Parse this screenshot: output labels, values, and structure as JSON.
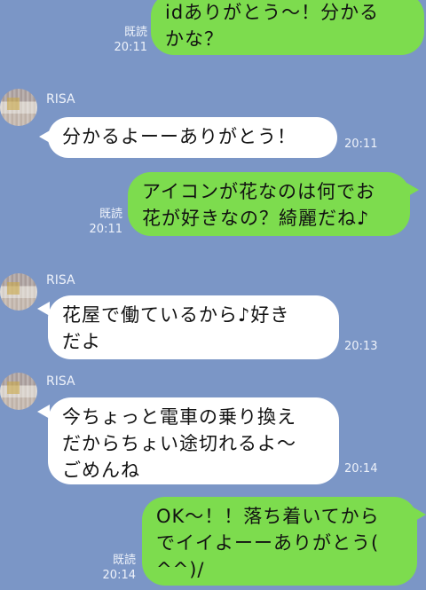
{
  "messages": [
    {
      "id": "m1",
      "side": "out",
      "text": "idありがとう〜！分かる\nかな？",
      "read": "既読",
      "time": "20:11"
    },
    {
      "id": "m2",
      "side": "in",
      "sender": "RISA",
      "text": "分かるよーーありがとう！",
      "time": "20:11"
    },
    {
      "id": "m3",
      "side": "out",
      "text": "アイコンが花なのは何でお\n花が好きなの？綺麗だね♪",
      "read": "既読",
      "time": "20:11"
    },
    {
      "id": "m4",
      "side": "in",
      "sender": "RISA",
      "text": "花屋で働ているから♪好き\nだよ",
      "time": "20:13"
    },
    {
      "id": "m5",
      "side": "in",
      "sender": "RISA",
      "text": "今ちょっと電車の乗り換え\nだからちょい途切れるよ〜\nごめんね",
      "time": "20:14"
    },
    {
      "id": "m6",
      "side": "out",
      "text": "OK〜！！落ち着いてから\nでイイよーーありがとう(\n^^)/",
      "read": "既読",
      "time": "20:14"
    }
  ]
}
